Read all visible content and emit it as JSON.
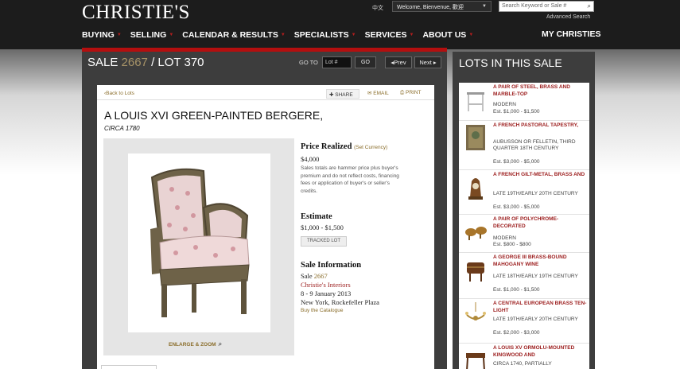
{
  "header": {
    "logo": "CHRISTIE'S",
    "lang": "中文",
    "welcome": "Welcome, Bienvenue, 歡迎",
    "search_placeholder": "Search Keyword or Sale #",
    "advanced_search": "Advanced Search"
  },
  "nav": {
    "items": [
      "BUYING",
      "SELLING",
      "CALENDAR & RESULTS",
      "SPECIALISTS",
      "SERVICES",
      "ABOUT US"
    ],
    "my_christies": "MY CHRISTIES"
  },
  "sale_bar": {
    "sale_label": "SALE",
    "sale_number": "2667",
    "lot_label": "/ LOT",
    "lot_number": "370",
    "goto_label": "GO TO",
    "lot_input_placeholder": "Lot #",
    "go_label": "GO",
    "prev_label": "◂Prev",
    "next_label": "Next ▸"
  },
  "lot": {
    "back_label": "‹Back to Lots",
    "share_label": "SHARE",
    "email_label": "EMAIL",
    "print_label": "PRINT",
    "title": "A LOUIS XVI GREEN-PAINTED BERGERE,",
    "circa": "CIRCA 1780",
    "enlarge_label": "ENLARGE & ZOOM",
    "price_realized_heading": "Price Realized",
    "set_currency": "(Set Currency)",
    "price_realized": "$4,000",
    "price_note": "Sales totals are hammer price plus buyer's premium and do not reflect costs, financing fees or application of buyer's or seller's credits.",
    "estimate_heading": "Estimate",
    "estimate": "$1,000 - $1,500",
    "tracked_label": "TRACKED LOT",
    "sale_info_heading": "Sale Information",
    "sale_prefix": "Sale",
    "sale_number": "2667",
    "sale_name": "Christie's Interiors",
    "sale_dates": "8 - 9 January 2013",
    "sale_location": "New York, Rockefeller Plaza",
    "buy_catalogue": "Buy the Catalogue"
  },
  "sidebar": {
    "title": "LOTS IN THIS SALE",
    "items": [
      {
        "name": "A PAIR OF STEEL, BRASS AND MARBLE-TOP",
        "desc": "MODERN",
        "est": "Est. $1,000 - $1,500",
        "icon": "table-icon"
      },
      {
        "name": "A FRENCH PASTORAL TAPESTRY,",
        "desc": "AUBUSSON OR FELLETIN, THIRD QUARTER 18TH CENTURY",
        "est": "Est. $3,000 - $5,000",
        "icon": "tapestry-icon"
      },
      {
        "name": "A FRENCH GILT-METAL, BRASS AND",
        "desc": "LATE 19TH/EARLY 20TH CENTURY",
        "est": "Est. $3,000 - $5,000",
        "icon": "clock-icon"
      },
      {
        "name": "A PAIR OF POLYCHROME-DECORATED",
        "desc": "MODERN",
        "est": "Est. $800 - $800",
        "icon": "figurines-icon"
      },
      {
        "name": "A GEORGE III BRASS-BOUND MAHOGANY WINE",
        "desc": "LATE 18TH/EARLY 19TH CENTURY",
        "est": "Est. $1,000 - $1,500",
        "icon": "wine-cooler-icon"
      },
      {
        "name": "A CENTRAL EUROPEAN BRASS TEN-LIGHT",
        "desc": "LATE 19TH/EARLY 20TH CENTURY",
        "est": "Est. $2,000 - $3,000",
        "icon": "chandelier-icon"
      },
      {
        "name": "A LOUIS XV ORMOLU-MOUNTED KINGWOOD AND",
        "desc": "CIRCA 1740, PARTIALLY",
        "est": "",
        "icon": "desk-icon"
      }
    ]
  }
}
